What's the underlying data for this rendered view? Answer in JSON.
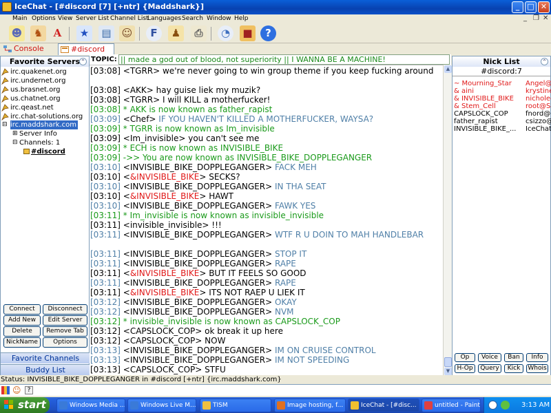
{
  "window": {
    "title": "IceChat - [#discord [7] [+ntr] {Maddshark}]"
  },
  "menu": {
    "items": [
      "Main",
      "Options",
      "View",
      "Server List",
      "Channel List",
      "Languages",
      "Search",
      "Window",
      "Help"
    ]
  },
  "tabs": [
    {
      "label": "Console",
      "active": false
    },
    {
      "label": "#discord",
      "active": true
    }
  ],
  "favorite_servers": {
    "title": "Favorite Servers",
    "servers": [
      "irc.quakenet.org",
      "irc.undernet.org",
      "us.brasnet.org",
      "us.chatnet.org",
      "irc.qeast.net",
      "irc.chat-solutions.org"
    ],
    "connected": "irc.maddshark.com",
    "server_info": "Server Info",
    "channels_label": "Channels: 1",
    "channel": "#discord"
  },
  "left_buttons": {
    "connect": "Connect",
    "disconnect": "Disconnect",
    "add_new": "Add New",
    "edit_server": "Edit Server",
    "delete": "Delete",
    "remove_tab": "Remove Tab",
    "nickname": "NickName",
    "options": "Options",
    "favorite_channels": "Favorite Channels",
    "buddy_list": "Buddy List"
  },
  "topic": {
    "label": "TOPIC:",
    "text": "|| made a god out of blood, not superiority || I WANNA BE A MACHINE!"
  },
  "colors": {
    "normal": "#000000",
    "timestamp_alt": "#4f7fa7",
    "join_green": "#1a9a1a",
    "self_red": "#e01818",
    "topic_green": "#1a8a1a"
  },
  "chat_lines": [
    {
      "ts": "[03:08]",
      "text": " <TGRR> we're never going to win group theme if you keep fucking around",
      "color": "#000000",
      "wrap": true
    },
    {
      "ts": "[03:08]",
      "text": " <AKK> hay guise liek my muzik?",
      "color": "#000000"
    },
    {
      "ts": "[03:08]",
      "text": " <TGRR> I will KILL a motherfucker!",
      "color": "#000000"
    },
    {
      "ts": "[03:08]",
      "text": " * AKK is now known as father_rapist",
      "color": "#1a9a1a"
    },
    {
      "ts": "[03:09]",
      "text": " <Chef> IF YOU HAVEN'T KILLED A MOTHERFUCKER, WAYSA?",
      "color": "#4f7fa7",
      "prefix": " <Chef>",
      "prefix_color": "#000000",
      "rest": " IF YOU HAVEN'T KILLED A MOTHERFUCKER, WAYSA?"
    },
    {
      "ts": "[03:09]",
      "text": " * TGRR is now known as Im_invisible",
      "color": "#1a9a1a"
    },
    {
      "ts": "[03:09]",
      "text": " <Im_invisible> you can't see me",
      "color": "#000000"
    },
    {
      "ts": "[03:09]",
      "text": " * ECH is now known as INVISIBLE_BIKE",
      "color": "#1a9a1a"
    },
    {
      "ts": "[03:09]",
      "text": " ->> You are now known as INVISIBLE_BIKE_DOPPLEGANGER",
      "color": "#1a9a1a"
    },
    {
      "ts": "[03:10]",
      "text": "FACK MEH",
      "color": "#4f7fa7",
      "nick": "INVISIBLE_BIKE_DOPPLEGANGER",
      "nick_color": "#000000"
    },
    {
      "ts": "[03:10]",
      "text": "SECKS?",
      "color": "#000000",
      "nick": "&INVISIBLE_BIKE",
      "nick_color": "#e01818"
    },
    {
      "ts": "[03:10]",
      "text": "IN THA SEAT",
      "color": "#4f7fa7",
      "nick": "INVISIBLE_BIKE_DOPPLEGANGER",
      "nick_color": "#000000"
    },
    {
      "ts": "[03:10]",
      "text": "HAWT",
      "color": "#000000",
      "nick": "&INVISIBLE_BIKE",
      "nick_color": "#e01818"
    },
    {
      "ts": "[03:10]",
      "text": "FAWK YES",
      "color": "#4f7fa7",
      "nick": "INVISIBLE_BIKE_DOPPLEGANGER",
      "nick_color": "#000000"
    },
    {
      "ts": "[03:11]",
      "text": " * Im_invisible is now known as invisible_invisible",
      "color": "#1a9a1a"
    },
    {
      "ts": "[03:11]",
      "text": " <invisible_invisible> !!!",
      "color": "#000000"
    },
    {
      "ts": "[03:11]",
      "text": "WTF R U DOIN TO MAH HANDLEBAR",
      "color": "#4f7fa7",
      "nick": "INVISIBLE_BIKE_DOPPLEGANGER",
      "nick_color": "#000000",
      "wrap": true
    },
    {
      "ts": "[03:11]",
      "text": "STOP IT",
      "color": "#4f7fa7",
      "nick": "INVISIBLE_BIKE_DOPPLEGANGER",
      "nick_color": "#000000"
    },
    {
      "ts": "[03:11]",
      "text": "RAPE",
      "color": "#4f7fa7",
      "nick": "INVISIBLE_BIKE_DOPPLEGANGER",
      "nick_color": "#000000"
    },
    {
      "ts": "[03:11]",
      "text": "BUT IT FEELS SO GOOD",
      "color": "#000000",
      "nick": "&INVISIBLE_BIKE",
      "nick_color": "#e01818"
    },
    {
      "ts": "[03:11]",
      "text": "RAPE",
      "color": "#4f7fa7",
      "nick": "INVISIBLE_BIKE_DOPPLEGANGER",
      "nick_color": "#000000"
    },
    {
      "ts": "[03:11]",
      "text": "ITS NOT RAEP U LIEK IT",
      "color": "#000000",
      "nick": "&INVISIBLE_BIKE",
      "nick_color": "#e01818"
    },
    {
      "ts": "[03:12]",
      "text": "OKAY",
      "color": "#4f7fa7",
      "nick": "INVISIBLE_BIKE_DOPPLEGANGER",
      "nick_color": "#000000"
    },
    {
      "ts": "[03:12]",
      "text": "NVM",
      "color": "#4f7fa7",
      "nick": "INVISIBLE_BIKE_DOPPLEGANGER",
      "nick_color": "#000000"
    },
    {
      "ts": "[03:12]",
      "text": " * invisible_invisible is now known as CAPSLOCK_COP",
      "color": "#1a9a1a"
    },
    {
      "ts": "[03:12]",
      "text": " <CAPSLOCK_COP> ok break it up here",
      "color": "#000000"
    },
    {
      "ts": "[03:12]",
      "text": " <CAPSLOCK_COP> NOW",
      "color": "#000000"
    },
    {
      "ts": "[03:13]",
      "text": "IM ON CRUISE CONTROL",
      "color": "#4f7fa7",
      "nick": "INVISIBLE_BIKE_DOPPLEGANGER",
      "nick_color": "#000000"
    },
    {
      "ts": "[03:13]",
      "text": "IM NOT SPEEDING",
      "color": "#4f7fa7",
      "nick": "INVISIBLE_BIKE_DOPPLEGANGER",
      "nick_color": "#000000"
    },
    {
      "ts": "[03:13]",
      "text": " <CAPSLOCK_COP> STFU",
      "color": "#000000"
    }
  ],
  "nick_list": {
    "title": "Nick List",
    "channel": "#discord:7",
    "nicks": [
      {
        "nick": "~ Mourning_Star",
        "host": "Angel@I",
        "color": "#e01818"
      },
      {
        "nick": "& aini",
        "host": "krystine",
        "color": "#e01818"
      },
      {
        "nick": "& INVISIBLE_BIKE",
        "host": "nichole@",
        "color": "#e01818"
      },
      {
        "nick": "& Stem_Cell",
        "host": "root@S",
        "color": "#e01818"
      },
      {
        "nick": "CAPSLOCK_COP",
        "host": "fnord@I",
        "color": "#000000"
      },
      {
        "nick": "father_rapist",
        "host": "csizzo@",
        "color": "#000000"
      },
      {
        "nick": "INVISIBLE_BIKE_...",
        "host": "IceChat",
        "color": "#000000"
      }
    ]
  },
  "nick_buttons": {
    "op": "Op",
    "voice": "Voice",
    "ban": "Ban",
    "info": "Info",
    "hop": "H-Op",
    "query": "Query",
    "kick": "Kick",
    "whois": "Whois"
  },
  "status": {
    "text": "Status: INVISIBLE_BIKE_DOPPLEGANGER in #discord [+ntr] {irc.maddshark.com}"
  },
  "input": {
    "value": "",
    "help": "?"
  },
  "taskbar": {
    "start": "start",
    "tasks": [
      {
        "label": "Windows Media ...",
        "active": false,
        "icon_color": "#3a7ad8"
      },
      {
        "label": "Windows Live M...",
        "active": false,
        "icon_color": "#3a7ad8"
      },
      {
        "label": "TISM",
        "active": false,
        "icon_color": "#f0c040"
      },
      {
        "label": "Image hosting, f...",
        "active": false,
        "icon_color": "#e07020"
      },
      {
        "label": "IceChat - [#disc...",
        "active": true,
        "icon_color": "#f0c030"
      },
      {
        "label": "untitled - Paint",
        "active": false,
        "icon_color": "#e04040"
      }
    ],
    "clock": "3:13 AM"
  }
}
